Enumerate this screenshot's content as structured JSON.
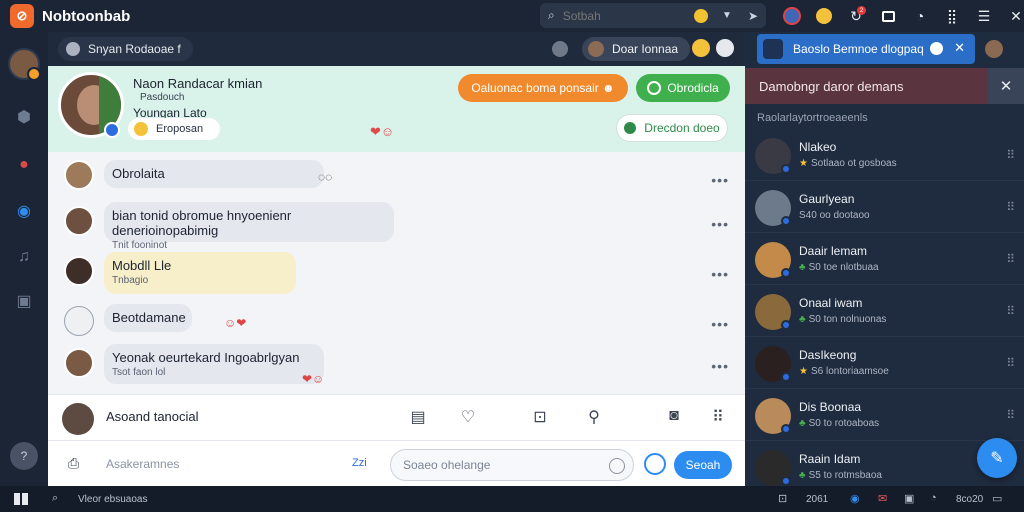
{
  "app": {
    "title": "Nobtoonbab",
    "logo_glyph": "⊘"
  },
  "search": {
    "placeholder": "Sotbah"
  },
  "topbar": {
    "notif_count": "2"
  },
  "chat_strip": {
    "left_chip": "Snyan Rodaoae f",
    "right_chip": "Doar Ionnaa"
  },
  "chat_header": {
    "name": "Naon Randacar kmian",
    "sub1": "Pasdouch",
    "sub2": "Youngan Lato",
    "chip": "Eroposan",
    "btn_orange": "Oaluonac boma ponsair ☻",
    "btn_green": "Obrodicla",
    "btn_white": "Drecdon doeo"
  },
  "messages": [
    {
      "text": "Obrolaita",
      "sub": ""
    },
    {
      "text": "bian tonid obromue hnyoenienr denerioinopabimig",
      "sub": "Tnit fooninot"
    },
    {
      "text": "Mobdll Lle",
      "sub": "Tnbagio"
    },
    {
      "text": "Beotdamane",
      "sub": ""
    },
    {
      "text": "Yeonak oeurtekard Ingoabrlgyan",
      "sub": "Tsot faon lol"
    }
  ],
  "composer": {
    "label": "Asoand tanocial"
  },
  "input": {
    "placeholder": "Asakeramnes",
    "tag": "Zzi",
    "reply_placeholder": "Soaeo ohelange",
    "send_label": "Seoah"
  },
  "right_panel": {
    "tab_label": "Baoslo Bemnoe dlogpaq",
    "header": "Damobngr daror demans",
    "section": "Raolarlaytortroeaeenls",
    "contacts": [
      {
        "name": "Nlakeo",
        "meta": "Sotlaao ot gosboas",
        "badge": "star"
      },
      {
        "name": "Gaurlyean",
        "meta": "S40 oo dootaoo",
        "badge": "none"
      },
      {
        "name": "Daair lemam",
        "meta": "S0 toe nlotbuaa",
        "badge": "leaf"
      },
      {
        "name": "Onaal iwam",
        "meta": "S0 ton nolnuonas",
        "badge": "leaf"
      },
      {
        "name": "DasIkeong",
        "meta": "S6 lontoriaamsoe",
        "badge": "star"
      },
      {
        "name": "Dis Boonaa",
        "meta": "S0 to rotoaboas",
        "badge": "leaf"
      },
      {
        "name": "Raain Idam",
        "meta": "S5 to rotmsbaoa",
        "badge": "leaf"
      }
    ]
  },
  "taskbar": {
    "left_text": "Vleor ebsuaoas",
    "time": "2061",
    "right_text": "8co20"
  },
  "colors": {
    "accent": "#2d8cf0",
    "orange": "#f08a2c",
    "green": "#3fb04d",
    "header_bg": "#d9f2ea",
    "alert": "#5a3540"
  }
}
